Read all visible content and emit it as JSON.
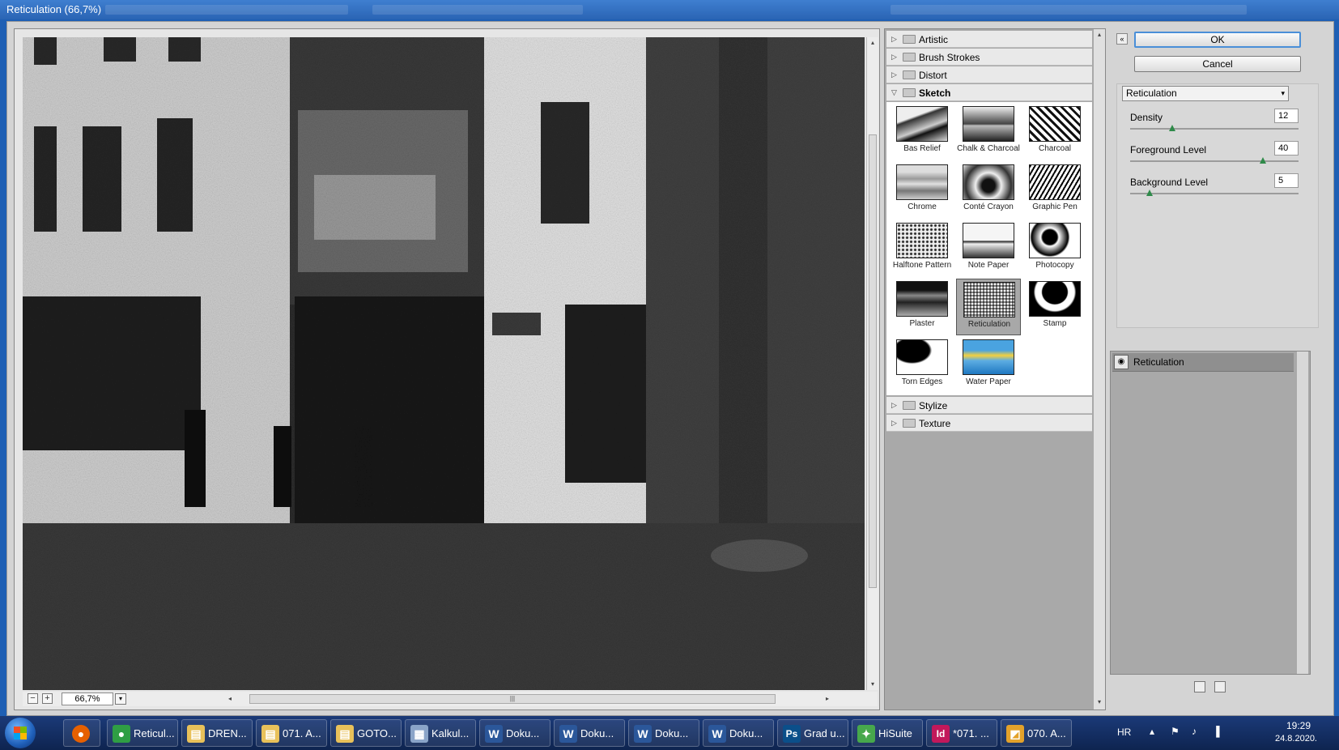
{
  "window": {
    "title": "Reticulation (66,7%)"
  },
  "preview": {
    "zoom": "66,7%",
    "zoom_out": "−",
    "zoom_in": "+",
    "dropdown": "▾",
    "h_grip": "|||",
    "scroll_left": "◂",
    "scroll_right": "▸",
    "scroll_up": "▴",
    "scroll_down": "▾"
  },
  "gallery": {
    "categories_before": [
      {
        "label": "Artistic",
        "open": false
      },
      {
        "label": "Brush Strokes",
        "open": false
      },
      {
        "label": "Distort",
        "open": false
      },
      {
        "label": "Sketch",
        "open": true
      }
    ],
    "thumbnails": [
      {
        "label": "Bas Relief"
      },
      {
        "label": "Chalk & Charcoal"
      },
      {
        "label": "Charcoal"
      },
      {
        "label": "Chrome"
      },
      {
        "label": "Conté Crayon"
      },
      {
        "label": "Graphic Pen"
      },
      {
        "label": "Halftone Pattern"
      },
      {
        "label": "Note Paper"
      },
      {
        "label": "Photocopy"
      },
      {
        "label": "Plaster"
      },
      {
        "label": "Reticulation",
        "selected": true
      },
      {
        "label": "Stamp"
      },
      {
        "label": "Torn Edges"
      },
      {
        "label": "Water Paper"
      }
    ],
    "categories_after": [
      {
        "label": "Stylize",
        "open": false
      },
      {
        "label": "Texture",
        "open": false
      }
    ],
    "tri_closed": "▷",
    "tri_open": "▽"
  },
  "buttons": {
    "ok": "OK",
    "cancel": "Cancel",
    "collapse": "«"
  },
  "settings": {
    "filter": "Reticulation",
    "dropdown_arrow": "▾",
    "params": [
      {
        "label": "Density",
        "value": "12",
        "min": 0,
        "max": 50
      },
      {
        "label": "Foreground Level",
        "value": "40",
        "min": 0,
        "max": 50
      },
      {
        "label": "Background Level",
        "value": "5",
        "min": 0,
        "max": 50
      }
    ]
  },
  "layers": {
    "items": [
      {
        "name": "Reticulation"
      }
    ],
    "eye": "◉"
  },
  "taskbar": {
    "items": [
      {
        "label": "Reticul...",
        "icon": "chrome-icon",
        "color": "#2f9e44",
        "glyph": "●"
      },
      {
        "label": "DREN...",
        "icon": "folder-icon",
        "color": "#e8c15a",
        "glyph": "▤"
      },
      {
        "label": "071. A...",
        "icon": "folder-icon",
        "color": "#e8c15a",
        "glyph": "▤"
      },
      {
        "label": "GOTO...",
        "icon": "folder-icon",
        "color": "#e8c15a",
        "glyph": "▤"
      },
      {
        "label": "Kalkul...",
        "icon": "calculator-icon",
        "color": "#8aa4c8",
        "glyph": "▦"
      },
      {
        "label": "Doku...",
        "icon": "word-icon",
        "color": "#2b579a",
        "glyph": "W"
      },
      {
        "label": "Doku...",
        "icon": "word-icon",
        "color": "#2b579a",
        "glyph": "W"
      },
      {
        "label": "Doku...",
        "icon": "word-icon",
        "color": "#2b579a",
        "glyph": "W"
      },
      {
        "label": "Doku...",
        "icon": "word-icon",
        "color": "#2b579a",
        "glyph": "W"
      },
      {
        "label": "Grad u...",
        "icon": "photoshop-icon",
        "color": "#0b4f8a",
        "glyph": "Ps"
      },
      {
        "label": "HiSuite",
        "icon": "hisuite-icon",
        "color": "#47a84c",
        "glyph": "✦"
      },
      {
        "label": "*071. ...",
        "icon": "indesign-icon",
        "color": "#c2185b",
        "glyph": "Id"
      },
      {
        "label": "070. A...",
        "icon": "app-icon",
        "color": "#e3a22b",
        "glyph": "◩"
      }
    ],
    "firefox_glyph": "●",
    "tray": {
      "lang": "HR",
      "up": "▴",
      "flag": "⚑",
      "volume": "♪",
      "signal": "▐",
      "time": "19:29",
      "date": "24.8.2020."
    }
  }
}
